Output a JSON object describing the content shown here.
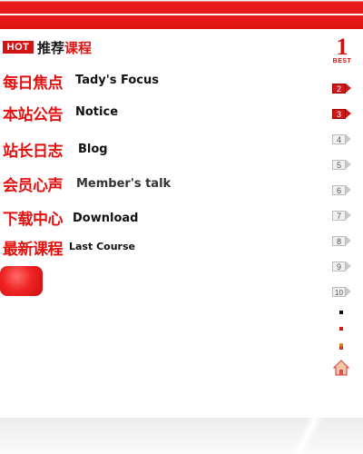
{
  "hot": {
    "badge": "HOT",
    "title_a": "推荐",
    "title_b": "课程"
  },
  "menu": [
    {
      "cn": "每日焦点",
      "en": "Tady's Focus"
    },
    {
      "cn": "本站公告",
      "en": "Notice"
    },
    {
      "cn": "站长日志",
      "en": "Blog"
    },
    {
      "cn": "会员心声",
      "en": "Member's  talk"
    },
    {
      "cn": "下载中心",
      "en": "Download"
    },
    {
      "cn": "最新课程",
      "en": "Last Course"
    }
  ],
  "ranking": {
    "first_number": "1",
    "first_label": "BEST",
    "numbers": [
      "2",
      "3",
      "4",
      "5",
      "6",
      "7",
      "8",
      "9",
      "10"
    ]
  },
  "colors": {
    "brand_red": "#e31010",
    "dark": "#111111",
    "rank_grey": "#c8c8c8"
  }
}
